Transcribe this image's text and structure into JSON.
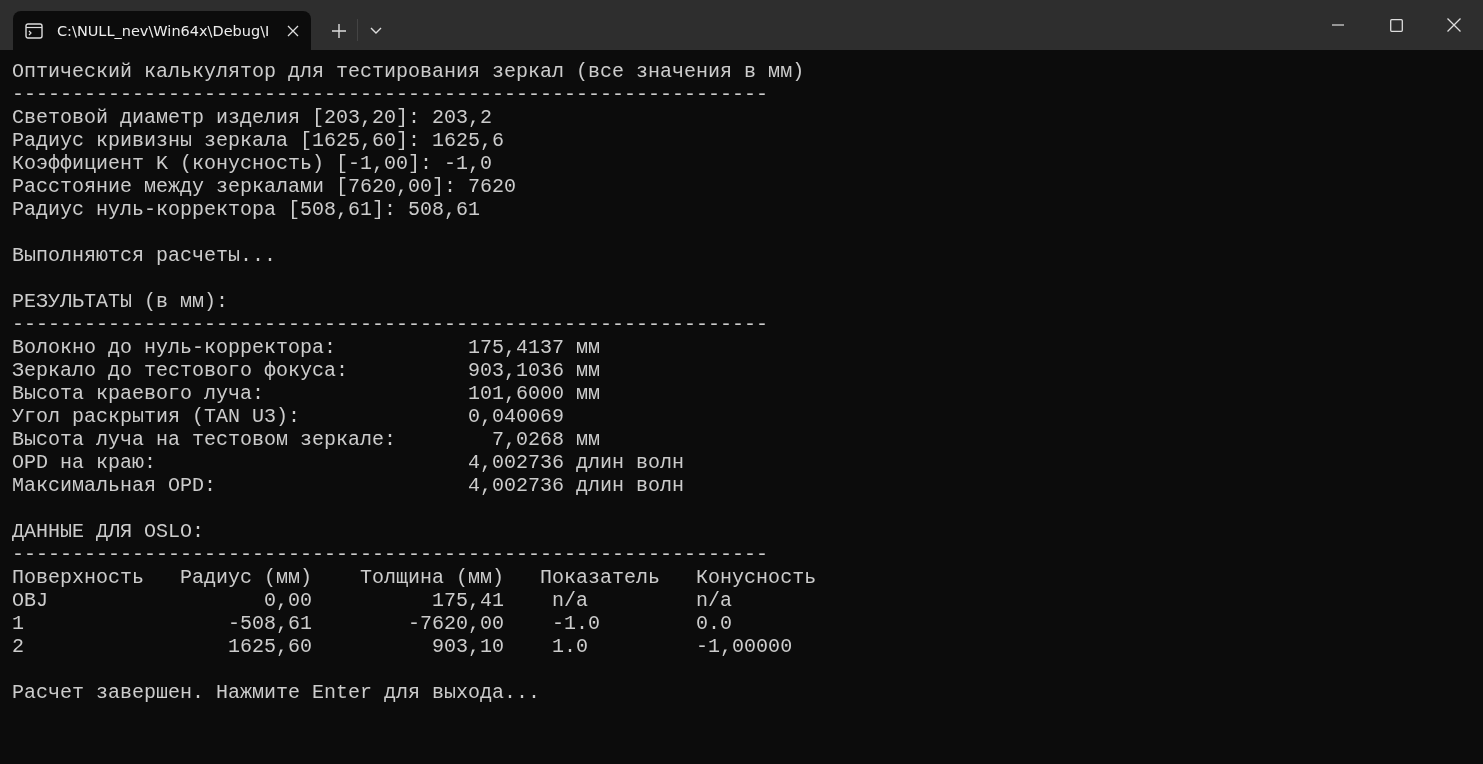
{
  "tab": {
    "title": "C:\\NULL_nev\\Win64x\\Debug\\I",
    "selected": true
  },
  "console": {
    "blocks": [
      [
        "Оптический калькулятор для тестирования зеркал (все значения в мм)",
        "---------------------------------------------------------------",
        "Световой диаметр изделия [203,20]: 203,2",
        "Радиус кривизны зеркала [1625,60]: 1625,6",
        "Коэффициент K (конусность) [-1,00]: -1,0",
        "Расстояние между зеркалами [7620,00]: 7620",
        "Радиус нуль-корректора [508,61]: 508,61"
      ],
      [
        "Выполняются расчеты..."
      ],
      [
        "РЕЗУЛЬТАТЫ (в мм):",
        "---------------------------------------------------------------",
        "Волокно до нуль-корректора:           175,4137 мм",
        "Зеркало до тестового фокуса:          903,1036 мм",
        "Высота краевого луча:                 101,6000 мм",
        "Угол раскрытия (TAN U3):              0,040069",
        "Высота луча на тестовом зеркале:        7,0268 мм",
        "OPD на краю:                          4,002736 длин волн",
        "Максимальная OPD:                     4,002736 длин волн"
      ],
      [
        "ДАННЫЕ ДЛЯ OSLO:",
        "---------------------------------------------------------------",
        "Поверхность   Радиус (мм)    Толщина (мм)   Показатель   Конусность",
        "OBJ                  0,00          175,41    n/a         n/a",
        "1                 -508,61        -7620,00    -1.0        0.0",
        "2                 1625,60          903,10    1.0         -1,00000"
      ],
      [
        "Расчет завершен. Нажмите Enter для выхода..."
      ]
    ]
  }
}
